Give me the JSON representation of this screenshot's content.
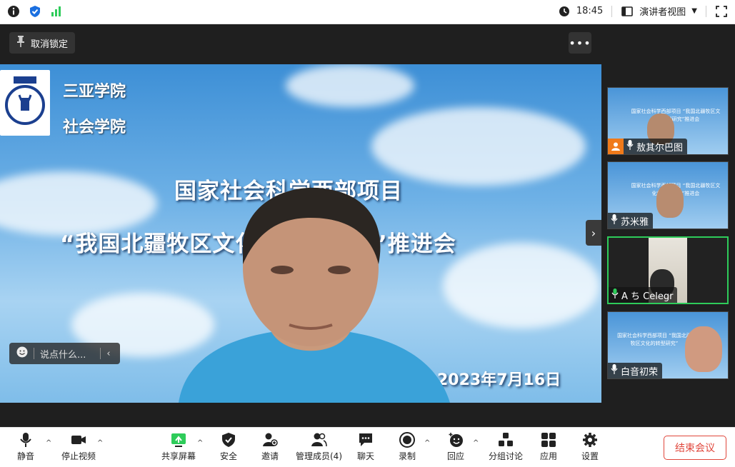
{
  "topbar": {
    "time": "18:45",
    "view_label": "演讲者视图",
    "icons": [
      "info-icon",
      "shield-check-icon",
      "signal-icon",
      "clock-icon",
      "speaker-view-icon",
      "chevron-down-icon",
      "fullscreen-icon"
    ]
  },
  "stage": {
    "unlock_label": "取消锁定",
    "more_label": "•••",
    "slide": {
      "school_line1": "三亚学院",
      "school_line2": "社会学院",
      "title_line1": "国家社会科学西部项目",
      "title_line2": "“我国北疆牧区文化的转型研究”推进会",
      "date": "2023年7月16日"
    },
    "chat_placeholder": "说点什么...",
    "expand_label": "›"
  },
  "participants": [
    {
      "name": "敖其尔巴图",
      "slide_text": "国家社会科学西部项目 “我国北疆牧区文化的转型研究”推进会"
    },
    {
      "name": "苏米雅",
      "slide_text": "国家社会科学西部项目 “我国北疆牧区文化的转型研究”推进会"
    },
    {
      "name": "A ち Celegr",
      "slide_text": ""
    },
    {
      "name": "白音初荣",
      "slide_text": "国家社会科学西部项目 “我国北疆牧区文化的转型研究”"
    }
  ],
  "toolbar": {
    "mute": "静音",
    "stop_video": "停止视频",
    "share_screen": "共享屏幕",
    "security": "安全",
    "invite": "邀请",
    "manage_members": "管理成员(4)",
    "chat": "聊天",
    "record": "录制",
    "reactions": "回应",
    "breakout": "分组讨论",
    "apps": "应用",
    "settings": "设置",
    "end_meeting": "结束会议"
  },
  "colors": {
    "active_speaker_border": "#2ecc5a",
    "end_button": "#e0463b",
    "share_green": "#2ecc5a"
  }
}
